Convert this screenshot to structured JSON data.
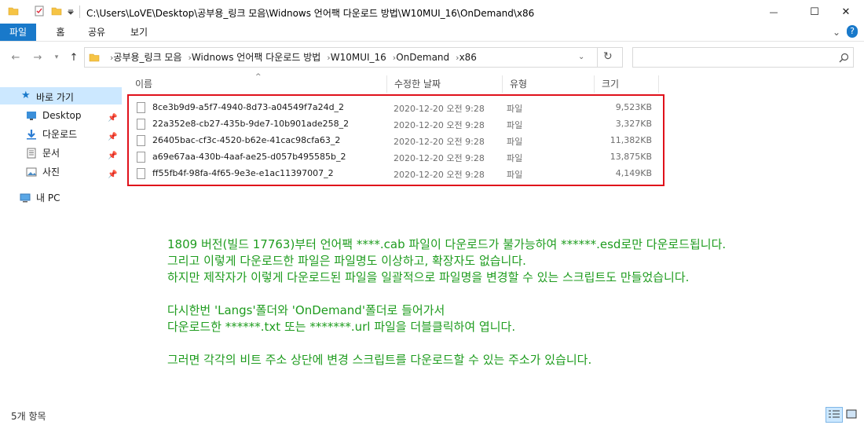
{
  "window": {
    "title": "C:\\Users\\LoVE\\Desktop\\공부용_링크 모음\\Widnows 언어팩 다운로드 방법\\W10MUI_16\\OnDemand\\x86",
    "minimize_glyph": "—",
    "maximize_glyph": "☐",
    "close_glyph": "✕"
  },
  "ribbon": {
    "tabs": [
      "파일",
      "홈",
      "공유",
      "보기"
    ],
    "collapse_glyph": "⌄",
    "help_glyph": "?"
  },
  "address": {
    "breadcrumbs": [
      "공부용_링크 모음",
      "Widnows 언어팩 다운로드 방법",
      "W10MUI_16",
      "OnDemand",
      "x86"
    ],
    "separator": "›",
    "search_placeholder": ""
  },
  "sidebar": {
    "quick_access": "바로 가기",
    "items": [
      {
        "label": "Desktop",
        "icon": "desktop-icon"
      },
      {
        "label": "다운로드",
        "icon": "download-icon"
      },
      {
        "label": "문서",
        "icon": "document-icon"
      },
      {
        "label": "사진",
        "icon": "pictures-icon"
      }
    ],
    "this_pc": "내 PC"
  },
  "columns": {
    "name": "이름",
    "date": "수정한 날짜",
    "type": "유형",
    "size": "크기"
  },
  "files": [
    {
      "name": "8ce3b9d9-a5f7-4940-8d73-a04549f7a24d_2",
      "date": "2020-12-20 오전 9:28",
      "type": "파일",
      "size": "9,523KB"
    },
    {
      "name": "22a352e8-cb27-435b-9de7-10b901ade258_2",
      "date": "2020-12-20 오전 9:28",
      "type": "파일",
      "size": "3,327KB"
    },
    {
      "name": "26405bac-cf3c-4520-b62e-41cac98cfa63_2",
      "date": "2020-12-20 오전 9:28",
      "type": "파일",
      "size": "11,382KB"
    },
    {
      "name": "a69e67aa-430b-4aaf-ae25-d057b495585b_2",
      "date": "2020-12-20 오전 9:28",
      "type": "파일",
      "size": "13,875KB"
    },
    {
      "name": "ff55fb4f-98fa-4f65-9e3e-e1ac11397007_2",
      "date": "2020-12-20 오전 9:28",
      "type": "파일",
      "size": "4,149KB"
    }
  ],
  "note": {
    "line1": "1809 버전(빌드 17763)부터 언어팩 ****.cab 파일이 다운로드가 불가능하여 ******.esd로만 다운로드됩니다.",
    "line2": "그리고 이렇게 다운로드한 파일은 파일명도 이상하고, 확장자도 없습니다.",
    "line3": "하지만 제작자가 이렇게 다운로드된 파일을 일괄적으로 파일명을 변경할 수 있는 스크립트도 만들었습니다.",
    "line4": "다시한번 'Langs'폴더와 'OnDemand'폴더로 들어가서",
    "line5": "다운로드한 ******.txt 또는 *******.url 파일을 더블클릭하여 엽니다.",
    "line6": "그러면 각각의 비트 주소 상단에 변경 스크립트를 다운로드할 수 있는 주소가 있습니다."
  },
  "status": {
    "item_count": "5개 항목"
  },
  "colors": {
    "accent": "#1979ca",
    "highlight_border": "#e0111b",
    "note_text": "#1e9c1e"
  }
}
